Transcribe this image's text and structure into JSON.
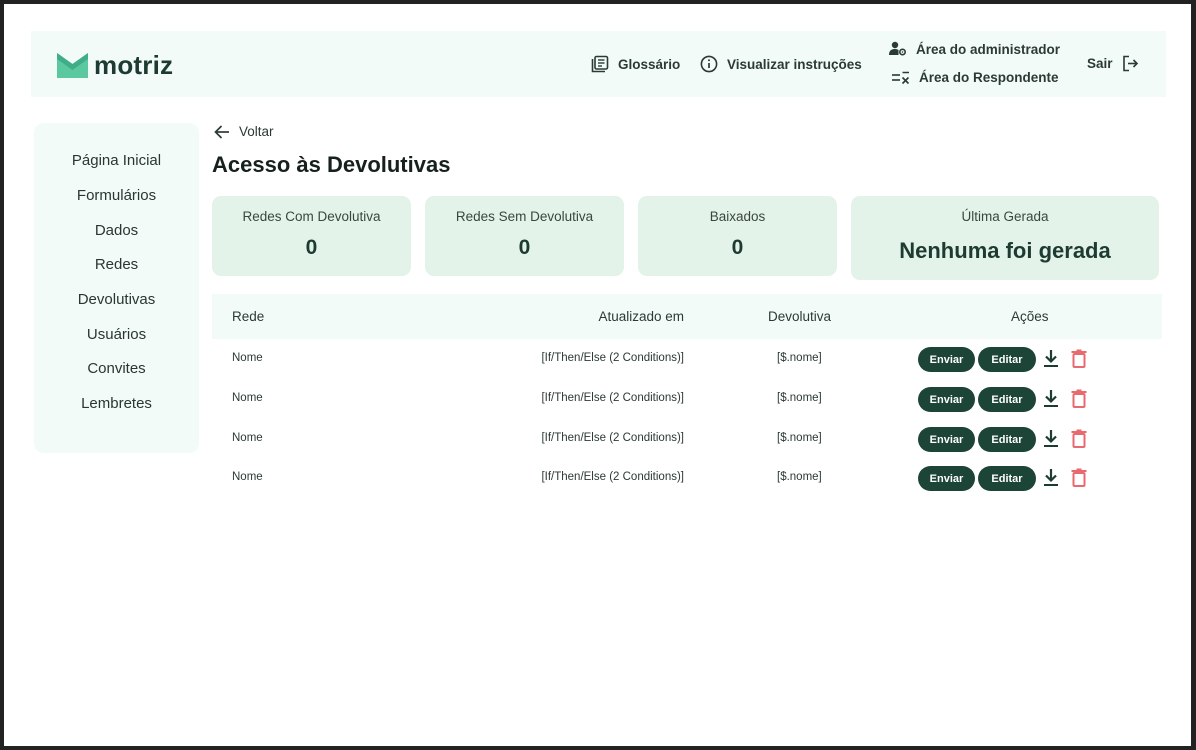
{
  "brand": {
    "name": "motriz"
  },
  "header": {
    "glossary": "Glossário",
    "instructions": "Visualizar instruções",
    "admin": "Área do administrador",
    "respondent": "Área do Respondente",
    "logout": "Sair"
  },
  "sidebar": {
    "items": [
      {
        "label": "Página Inicial"
      },
      {
        "label": "Formulários"
      },
      {
        "label": "Dados"
      },
      {
        "label": "Redes"
      },
      {
        "label": "Devolutivas"
      },
      {
        "label": "Usuários"
      },
      {
        "label": "Convites"
      },
      {
        "label": "Lembretes"
      }
    ]
  },
  "main": {
    "back": "Voltar",
    "title": "Acesso às Devolutivas",
    "cards": [
      {
        "label": "Redes Com Devolutiva",
        "value": "0"
      },
      {
        "label": "Redes Sem Devolutiva",
        "value": "0"
      },
      {
        "label": "Baixados",
        "value": "0"
      },
      {
        "label": "Última Gerada",
        "value": "Nenhuma foi gerada"
      }
    ],
    "table": {
      "headers": [
        "Rede",
        "Atualizado em",
        "Devolutiva",
        "Ações"
      ],
      "rows": [
        {
          "rede": "Nome",
          "atualizado": "[If/Then/Else (2 Conditions)]",
          "devolutiva": "[$.nome]",
          "send": "Enviar",
          "edit": "Editar"
        },
        {
          "rede": "Nome",
          "atualizado": "[If/Then/Else (2 Conditions)]",
          "devolutiva": "[$.nome]",
          "send": "Enviar",
          "edit": "Editar"
        },
        {
          "rede": "Nome",
          "atualizado": "[If/Then/Else (2 Conditions)]",
          "devolutiva": "[$.nome]",
          "send": "Enviar",
          "edit": "Editar"
        },
        {
          "rede": "Nome",
          "atualizado": "[If/Then/Else (2 Conditions)]",
          "devolutiva": "[$.nome]",
          "send": "Enviar",
          "edit": "Editar"
        }
      ]
    }
  },
  "colors": {
    "brand_green": "#5bc8a0",
    "dark_green": "#1c4437",
    "card_bg": "#e3f3ea",
    "panel_bg": "#f2fbf8",
    "delete_red": "#e86a6f"
  }
}
